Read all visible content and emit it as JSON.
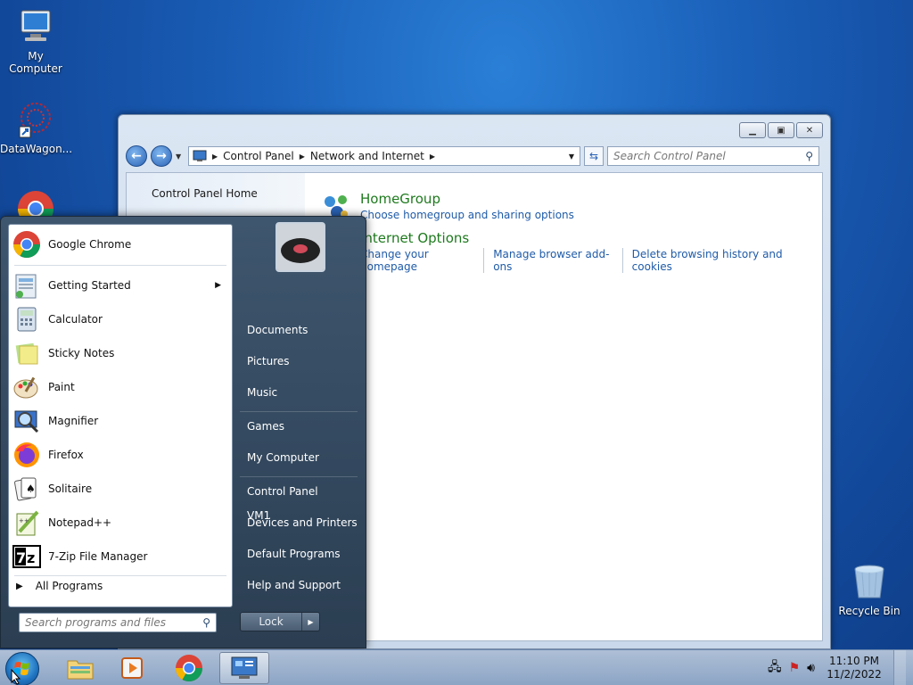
{
  "desktop": {
    "icons": [
      {
        "label": "My Computer"
      },
      {
        "label": "DataWagon..."
      },
      {
        "label": "Google Chrome"
      },
      {
        "label": "Recycle Bin"
      }
    ]
  },
  "window": {
    "address": {
      "crumbs": [
        "Control Panel",
        "Network and Internet"
      ]
    },
    "search_placeholder": "Search Control Panel",
    "left_pane": {
      "home_link": "Control Panel Home"
    },
    "categories": [
      {
        "title": "HomeGroup",
        "links": [
          "Choose homegroup and sharing options"
        ]
      },
      {
        "title": "Internet Options",
        "links": [
          "Change your homepage",
          "Manage browser add-ons",
          "Delete browsing history and cookies"
        ]
      }
    ]
  },
  "start_menu": {
    "programs": [
      {
        "label": "Google Chrome",
        "icon": "chrome-icon"
      },
      {
        "label": "Getting Started",
        "icon": "getting-started-icon",
        "has_submenu": true
      },
      {
        "label": "Calculator",
        "icon": "calculator-icon"
      },
      {
        "label": "Sticky Notes",
        "icon": "sticky-notes-icon"
      },
      {
        "label": "Paint",
        "icon": "paint-icon"
      },
      {
        "label": "Magnifier",
        "icon": "magnifier-icon"
      },
      {
        "label": "Firefox",
        "icon": "firefox-icon"
      },
      {
        "label": "Solitaire",
        "icon": "solitaire-icon"
      },
      {
        "label": "Notepad++",
        "icon": "notepadpp-icon"
      },
      {
        "label": "7-Zip File Manager",
        "icon": "7zip-icon"
      }
    ],
    "all_programs": "All Programs",
    "search_placeholder": "Search programs and files",
    "right_items": [
      {
        "label": "VM1"
      },
      {
        "label": "Documents"
      },
      {
        "label": "Pictures"
      },
      {
        "label": "Music"
      },
      {
        "label": "Games"
      },
      {
        "label": "My Computer"
      },
      {
        "label": "Control Panel"
      },
      {
        "label": "Devices and Printers"
      },
      {
        "label": "Default Programs"
      },
      {
        "label": "Help and Support"
      }
    ],
    "lock_label": "Lock"
  },
  "taskbar": {
    "clock_time": "11:10 PM",
    "clock_date": "11/2/2022"
  },
  "colors": {
    "category_title": "#1e7a1e",
    "link": "#1f5ba8",
    "desktop_bg": "#1a5fb8"
  }
}
